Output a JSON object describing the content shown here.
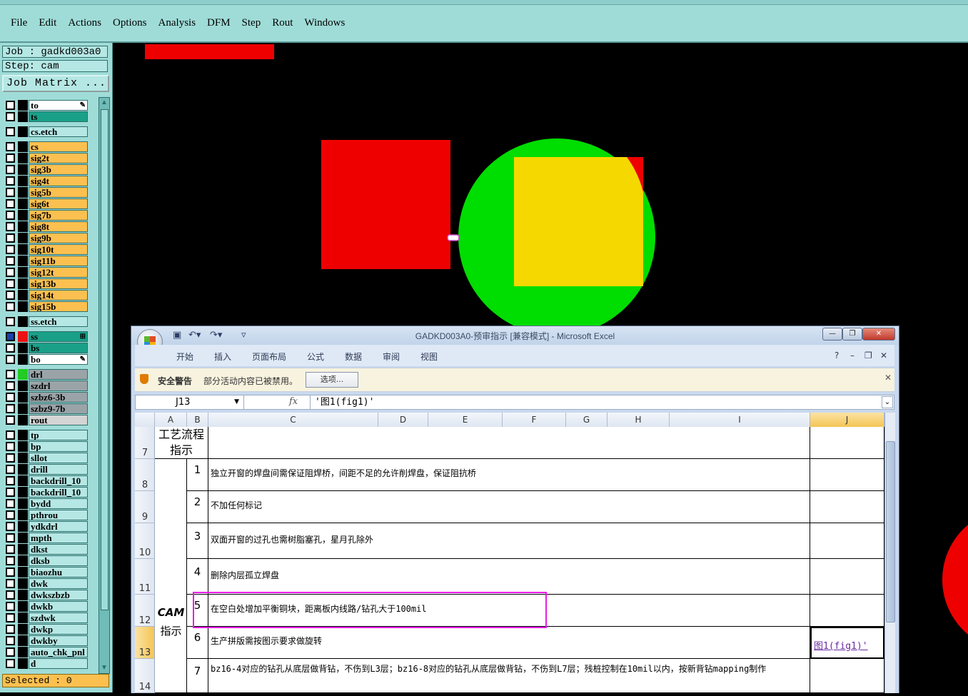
{
  "menubar": {
    "items": [
      "File",
      "Edit",
      "Actions",
      "Options",
      "Analysis",
      "DFM",
      "Step",
      "Rout",
      "Windows"
    ]
  },
  "left_panel": {
    "job": "Job : gadkd003a0",
    "step": "Step: cam",
    "job_matrix_button": "Job Matrix ...",
    "selected": "Selected : 0",
    "layers": [
      {
        "name": "to",
        "swatch": "#000000",
        "bg": "#ffffff",
        "mark": "✎"
      },
      {
        "name": "ts",
        "swatch": "#000000",
        "bg": "#1aa088"
      },
      {
        "name": "cs.etch",
        "swatch": "#000000",
        "bg": "#b5e7e4"
      },
      {
        "name": "cs",
        "swatch": "#000000",
        "bg": "#fcc050"
      },
      {
        "name": "sig2t",
        "swatch": "#000000",
        "bg": "#fcc050"
      },
      {
        "name": "sig3b",
        "swatch": "#000000",
        "bg": "#fcc050"
      },
      {
        "name": "sig4t",
        "swatch": "#000000",
        "bg": "#fcc050"
      },
      {
        "name": "sig5b",
        "swatch": "#000000",
        "bg": "#fcc050"
      },
      {
        "name": "sig6t",
        "swatch": "#000000",
        "bg": "#fcc050"
      },
      {
        "name": "sig7b",
        "swatch": "#000000",
        "bg": "#fcc050"
      },
      {
        "name": "sig8t",
        "swatch": "#000000",
        "bg": "#fcc050"
      },
      {
        "name": "sig9b",
        "swatch": "#000000",
        "bg": "#fcc050"
      },
      {
        "name": "sig10t",
        "swatch": "#000000",
        "bg": "#fcc050"
      },
      {
        "name": "sig11b",
        "swatch": "#000000",
        "bg": "#fcc050"
      },
      {
        "name": "sig12t",
        "swatch": "#000000",
        "bg": "#fcc050"
      },
      {
        "name": "sig13b",
        "swatch": "#000000",
        "bg": "#fcc050"
      },
      {
        "name": "sig14t",
        "swatch": "#000000",
        "bg": "#fcc050"
      },
      {
        "name": "sig15b",
        "swatch": "#000000",
        "bg": "#fcc050"
      },
      {
        "name": "ss.etch",
        "swatch": "#000000",
        "bg": "#b5e7e4"
      },
      {
        "name": "ss",
        "swatch": "#ee1111",
        "bg": "#1aa088",
        "checked": true,
        "mark": "⊞"
      },
      {
        "name": "bs",
        "swatch": "#000000",
        "bg": "#1aa088"
      },
      {
        "name": "bo",
        "swatch": "#000000",
        "bg": "#ffffff",
        "mark": "✎"
      },
      {
        "name": "drl",
        "swatch": "#22cc22",
        "bg": "#9aa4a8"
      },
      {
        "name": "szdrl",
        "swatch": "#000000",
        "bg": "#9aa4a8"
      },
      {
        "name": "szbz6-3b",
        "swatch": "#000000",
        "bg": "#9aa4a8"
      },
      {
        "name": "szbz9-7b",
        "swatch": "#000000",
        "bg": "#9aa4a8"
      },
      {
        "name": "rout",
        "swatch": "#000000",
        "bg": "#d4d4d4"
      },
      {
        "name": "tp",
        "swatch": "#000000",
        "bg": "#b5e7e4"
      },
      {
        "name": "bp",
        "swatch": "#000000",
        "bg": "#b5e7e4"
      },
      {
        "name": "sllot",
        "swatch": "#000000",
        "bg": "#b5e7e4"
      },
      {
        "name": "drill",
        "swatch": "#000000",
        "bg": "#b5e7e4"
      },
      {
        "name": "backdrill_10",
        "swatch": "#000000",
        "bg": "#b5e7e4"
      },
      {
        "name": "backdrill_10",
        "swatch": "#000000",
        "bg": "#b5e7e4"
      },
      {
        "name": "bydd",
        "swatch": "#000000",
        "bg": "#b5e7e4"
      },
      {
        "name": "pthrou",
        "swatch": "#000000",
        "bg": "#b5e7e4"
      },
      {
        "name": "ydkdrl",
        "swatch": "#000000",
        "bg": "#b5e7e4"
      },
      {
        "name": "mpth",
        "swatch": "#000000",
        "bg": "#b5e7e4"
      },
      {
        "name": "dkst",
        "swatch": "#000000",
        "bg": "#b5e7e4"
      },
      {
        "name": "dksb",
        "swatch": "#000000",
        "bg": "#b5e7e4"
      },
      {
        "name": "biaozhu",
        "swatch": "#000000",
        "bg": "#b5e7e4"
      },
      {
        "name": "dwk",
        "swatch": "#000000",
        "bg": "#b5e7e4"
      },
      {
        "name": "dwkszbzb",
        "swatch": "#000000",
        "bg": "#b5e7e4"
      },
      {
        "name": "dwkb",
        "swatch": "#000000",
        "bg": "#b5e7e4"
      },
      {
        "name": "szdwk",
        "swatch": "#000000",
        "bg": "#b5e7e4"
      },
      {
        "name": "dwkp",
        "swatch": "#000000",
        "bg": "#b5e7e4"
      },
      {
        "name": "dwkby",
        "swatch": "#000000",
        "bg": "#b5e7e4"
      },
      {
        "name": "auto_chk_pnl",
        "swatch": "#000000",
        "bg": "#b5e7e4"
      },
      {
        "name": "d",
        "swatch": "#000000",
        "bg": "#b5e7e4"
      }
    ]
  },
  "canvas_shapes": {
    "colors": {
      "red": "#ee0000",
      "green": "#00dd00",
      "yellow": "#f5d800",
      "white": "#ffffff"
    }
  },
  "excel": {
    "title": "GADKD003A0-预审指示  [兼容模式] - Microsoft Excel",
    "ribbon_tabs": [
      "开始",
      "插入",
      "页面布局",
      "公式",
      "数据",
      "审阅",
      "视图"
    ],
    "security_label": "安全警告",
    "security_message": "部分活动内容已被禁用。",
    "options_button": "选项...",
    "name_box": "J13",
    "formula_value": "'图1(fig1)'",
    "columns": [
      "A",
      "B",
      "C",
      "D",
      "E",
      "F",
      "G",
      "H",
      "I",
      "J"
    ],
    "selected_column": "J",
    "rows": [
      "7",
      "8",
      "9",
      "10",
      "11",
      "12",
      "13",
      "14"
    ],
    "selected_row": "13",
    "section1_label": "工艺流程指示",
    "section2_label_top": "CAM",
    "section2_label_bottom": "指示",
    "items": [
      {
        "num": "1",
        "text": "独立开窗的焊盘间需保证阻焊桥，间距不足的允许削焊盘，保证阻抗桥"
      },
      {
        "num": "2",
        "text": "不加任何标记"
      },
      {
        "num": "3",
        "text": "双面开窗的过孔也需树脂塞孔，星月孔除外"
      },
      {
        "num": "4",
        "text": "删除内层孤立焊盘"
      },
      {
        "num": "5",
        "text": "在空白处增加平衡铜块，距离板内线路/钻孔大于100mil"
      },
      {
        "num": "6",
        "text": "生产拼版需按图示要求做旋转"
      },
      {
        "num": "7",
        "text": "bz16-4对应的钻孔从底层做背钻，不伤到L3层；bz16-8对应的钻孔从底层做背钻，不伤到L7层；残桩控制在10mil以内，按新背钻mapping制作"
      }
    ],
    "link_cell": "图1(fig1)'"
  }
}
